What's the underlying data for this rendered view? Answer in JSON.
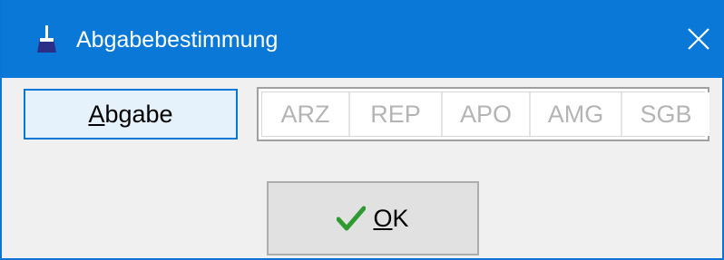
{
  "window": {
    "title": "Abgabebestimmung",
    "icon": "brush-icon",
    "close_icon": "close-icon",
    "colors": {
      "titlebar": "#0a78d7",
      "accent": "#0078d7"
    }
  },
  "abgabe_button": {
    "mnemonic": "A",
    "rest": "bgabe"
  },
  "codes": [
    "ARZ",
    "REP",
    "APO",
    "AMG",
    "SGB"
  ],
  "ok_button": {
    "mnemonic": "O",
    "rest": "K",
    "icon": "check-icon"
  }
}
